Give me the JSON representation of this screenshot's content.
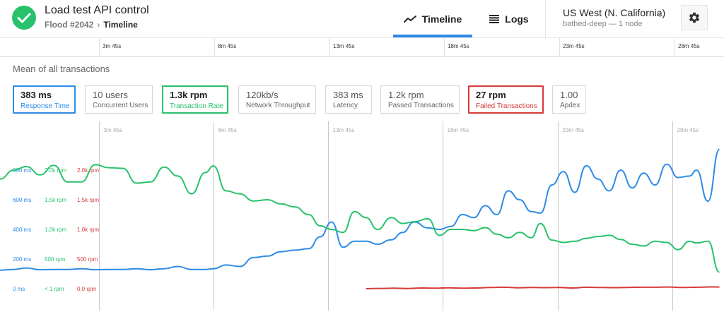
{
  "header": {
    "title": "Load test API control",
    "flood_label": "Flood #2042",
    "breadcrumb_current": "Timeline",
    "status_icon": "check-icon",
    "accent_color": "#2d8be6",
    "success_color": "#27c26b"
  },
  "tabs": [
    {
      "label": "Timeline",
      "icon": "chart-line-icon",
      "active": true
    },
    {
      "label": "Logs",
      "icon": "list-icon",
      "active": false
    }
  ],
  "region": {
    "name": "US West (N. California)",
    "subtitle": "bathed-deep — 1 node"
  },
  "ruler": {
    "labels": [
      "3m 45s",
      "8m 45s",
      "13m 45s",
      "18m 45s",
      "23m 45s",
      "28m 45s"
    ]
  },
  "section_title": "Mean of all transactions",
  "metrics": [
    {
      "value": "383 ms",
      "label": "Response Time",
      "selected": true,
      "color": "#2d8be6"
    },
    {
      "value": "10 users",
      "label": "Concurrent Users",
      "selected": false
    },
    {
      "value": "1.3k rpm",
      "label": "Transaction Rate",
      "selected": true,
      "color": "#27c26b"
    },
    {
      "value": "120kb/s",
      "label": "Network Throughput",
      "selected": false
    },
    {
      "value": "383 ms",
      "label": "Latency",
      "selected": false
    },
    {
      "value": "1.2k rpm",
      "label": "Passed Transactions",
      "selected": false
    },
    {
      "value": "27 rpm",
      "label": "Failed Transactions",
      "selected": true,
      "color": "#d63a3a"
    },
    {
      "value": "1.00",
      "label": "Apdex",
      "selected": false
    }
  ],
  "chart_data": {
    "type": "line",
    "x_unit": "minutes",
    "x_ticks": [
      {
        "x": 3.75,
        "label": "3m 45s"
      },
      {
        "x": 8.75,
        "label": "8m 45s"
      },
      {
        "x": 13.75,
        "label": "13m 45s"
      },
      {
        "x": 18.75,
        "label": "18m 45s"
      },
      {
        "x": 23.75,
        "label": "23m 45s"
      },
      {
        "x": 28.75,
        "label": "28m 45s"
      }
    ],
    "xlim": [
      -0.55,
      31.0
    ],
    "axes": [
      {
        "id": "response",
        "color": "#2d8be6",
        "ylim": [
          0,
          1000
        ],
        "tick_labels": [
          "0 ms",
          "200 ms",
          "400 ms",
          "600 ms",
          "800 ms"
        ]
      },
      {
        "id": "rate",
        "color": "#27c26b",
        "ylim": [
          0,
          2500
        ],
        "tick_labels": [
          "< 1 rpm",
          "500 rpm",
          "1.0k rpm",
          "1.5k rpm",
          "2.0k rpm"
        ]
      },
      {
        "id": "failed",
        "color": "#d63a3a",
        "ylim": [
          0,
          2500
        ],
        "tick_labels": [
          "0.0 rpm",
          "500 rpm",
          "1.0k rpm",
          "1.5k rpm",
          "2.0k rpm"
        ]
      }
    ],
    "series": [
      {
        "axis": "response",
        "color": "#2d8be6",
        "x": [
          -0.55,
          0.05,
          0.6,
          1.2,
          1.8,
          2.4,
          3.0,
          3.6,
          4.2,
          4.8,
          5.4,
          6.0,
          6.6,
          7.2,
          7.8,
          8.4,
          8.75,
          9.3,
          9.9,
          10.5,
          11.1,
          11.7,
          12.3,
          12.9,
          13.4,
          13.9,
          14.4,
          14.9,
          15.4,
          15.9,
          16.5,
          17.0,
          17.5,
          18.1,
          18.6,
          19.1,
          19.6,
          20.1,
          20.6,
          21.1,
          21.6,
          22.1,
          22.6,
          23.0,
          23.5,
          24.0,
          24.5,
          25.0,
          25.5,
          26.0,
          26.5,
          27.0,
          27.5,
          28.0,
          28.5,
          29.0,
          29.5,
          29.8,
          30.3,
          30.8
        ],
        "y": [
          125,
          130,
          140,
          128,
          130,
          130,
          135,
          128,
          130,
          130,
          135,
          128,
          135,
          150,
          130,
          130,
          135,
          160,
          150,
          210,
          220,
          250,
          260,
          270,
          350,
          450,
          280,
          320,
          320,
          300,
          330,
          380,
          450,
          410,
          400,
          420,
          500,
          480,
          560,
          500,
          660,
          600,
          520,
          510,
          700,
          790,
          650,
          830,
          740,
          660,
          800,
          680,
          780,
          700,
          840,
          750,
          760,
          800,
          590,
          940
        ]
      },
      {
        "axis": "rate",
        "color": "#27c26b",
        "x": [
          -0.55,
          0.05,
          0.6,
          1.2,
          1.8,
          2.4,
          3.0,
          3.6,
          4.2,
          4.8,
          5.4,
          6.0,
          6.6,
          7.2,
          7.8,
          8.4,
          8.75,
          9.3,
          9.9,
          10.5,
          11.1,
          11.7,
          12.3,
          12.9,
          13.4,
          13.9,
          14.4,
          14.9,
          15.4,
          15.9,
          16.5,
          17.0,
          17.5,
          18.1,
          18.6,
          19.1,
          19.6,
          20.1,
          20.6,
          21.1,
          21.6,
          22.1,
          22.6,
          23.0,
          23.5,
          24.0,
          24.5,
          25.0,
          25.5,
          26.0,
          26.5,
          27.0,
          27.5,
          28.0,
          28.5,
          29.0,
          29.5,
          29.8,
          30.3,
          30.8
        ],
        "y": [
          1850,
          2000,
          2060,
          1920,
          2080,
          1800,
          1800,
          2090,
          2040,
          2030,
          1780,
          1800,
          2050,
          1900,
          1600,
          1960,
          2070,
          1650,
          1600,
          1480,
          1500,
          1430,
          1380,
          1250,
          1060,
          1000,
          950,
          1300,
          1200,
          1000,
          1200,
          1100,
          1130,
          1180,
          900,
          1000,
          1000,
          980,
          1030,
          920,
          860,
          950,
          860,
          1100,
          820,
          780,
          800,
          850,
          880,
          900,
          830,
          750,
          720,
          800,
          780,
          660,
          800,
          770,
          800,
          280
        ]
      },
      {
        "axis": "failed",
        "color": "#d63a3a",
        "x": [
          15.4,
          16.0,
          16.6,
          17.2,
          17.8,
          18.4,
          19.0,
          19.6,
          20.2,
          20.8,
          21.4,
          22.0,
          22.6,
          23.2,
          23.8,
          24.4,
          25.0,
          25.6,
          26.2,
          26.8,
          27.4,
          28.0,
          28.6,
          29.2,
          29.8,
          30.4,
          30.8
        ],
        "y": [
          0,
          5,
          8,
          2,
          12,
          8,
          15,
          10,
          12,
          20,
          25,
          15,
          20,
          18,
          22,
          12,
          25,
          20,
          18,
          22,
          25,
          25,
          28,
          20,
          25,
          30,
          28
        ]
      }
    ]
  }
}
